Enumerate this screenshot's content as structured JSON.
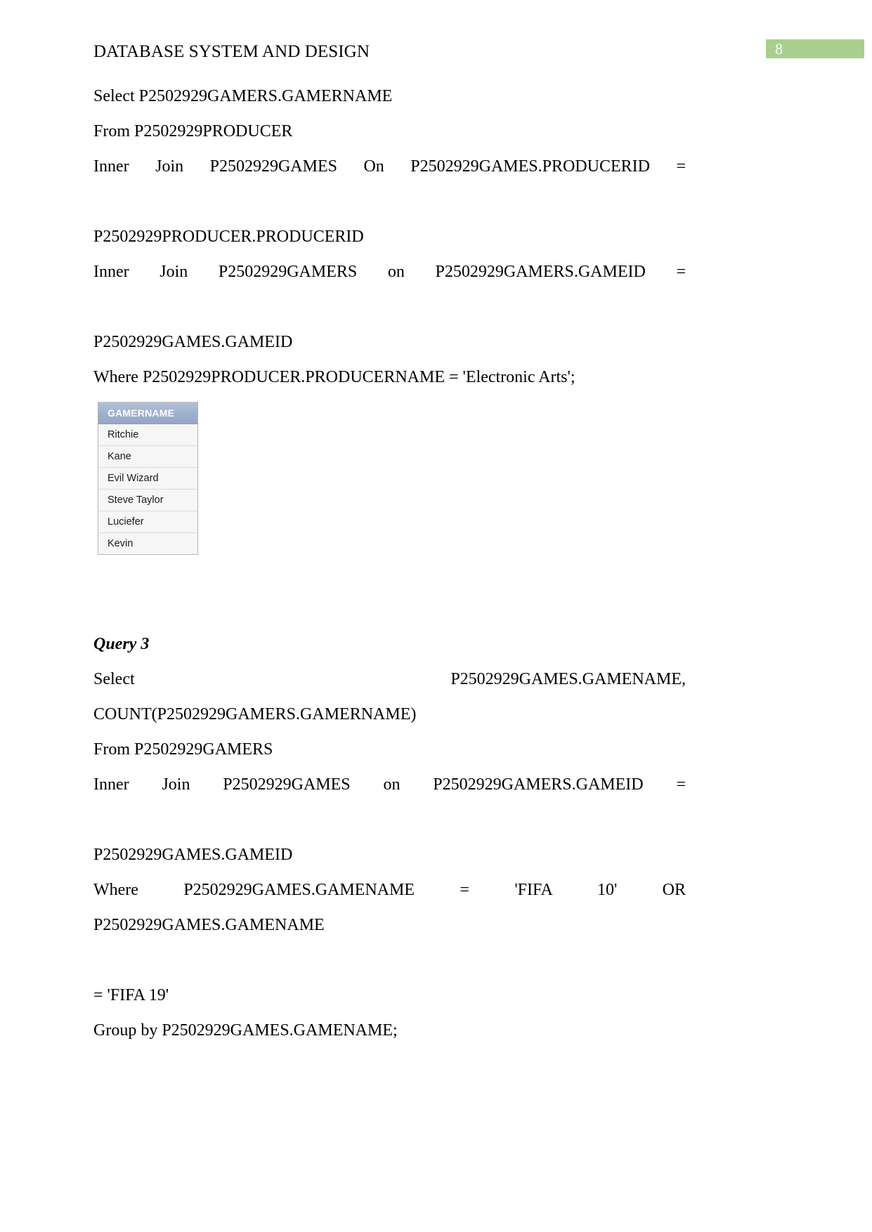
{
  "page": {
    "number_badge": "8",
    "badge_color": "#a9cf8e",
    "title": "DATABASE SYSTEM AND DESIGN"
  },
  "query2": {
    "lines": [
      "Select P2502929GAMERS.GAMERNAME",
      "From P2502929PRODUCER",
      "Inner Join P2502929GAMES On P2502929GAMES.PRODUCERID =",
      "P2502929PRODUCER.PRODUCERID",
      "Inner Join P2502929GAMERS on P2502929GAMERS.GAMEID =",
      "P2502929GAMES.GAMEID",
      "Where P2502929PRODUCER.PRODUCERNAME = 'Electronic Arts';"
    ]
  },
  "result_table": {
    "columns": [
      "GAMERNAME"
    ],
    "rows": [
      [
        "Ritchie"
      ],
      [
        "Kane"
      ],
      [
        "Evil Wizard"
      ],
      [
        "Steve Taylor"
      ],
      [
        "Luciefer"
      ],
      [
        "Kevin"
      ]
    ]
  },
  "query3": {
    "heading": "Query 3",
    "lines": [
      "Select P2502929GAMES.GAMENAME, COUNT(P2502929GAMERS.GAMERNAME)",
      "From P2502929GAMERS",
      "Inner Join P2502929GAMES on P2502929GAMERS.GAMEID =",
      "P2502929GAMES.GAMEID",
      "Where P2502929GAMES.GAMENAME = 'FIFA 10' OR P2502929GAMES.GAMENAME",
      "= 'FIFA 19'",
      "Group by P2502929GAMES.GAMENAME;"
    ]
  }
}
